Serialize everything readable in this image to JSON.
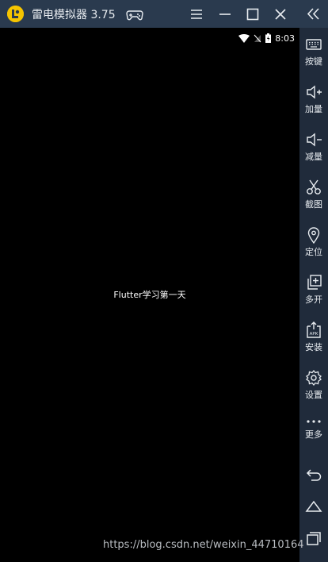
{
  "app": {
    "title": "雷电模拟器 3.75"
  },
  "status": {
    "time": "8:03"
  },
  "screen": {
    "center_text": "Flutter学习第一天",
    "watermark": "https://blog.csdn.net/weixin_44710164"
  },
  "sidebar": {
    "items": [
      {
        "label": "按键",
        "icon": "keyboard-icon"
      },
      {
        "label": "加量",
        "icon": "volume-up-icon"
      },
      {
        "label": "减量",
        "icon": "volume-down-icon"
      },
      {
        "label": "截图",
        "icon": "scissors-icon"
      },
      {
        "label": "定位",
        "icon": "location-pin-icon"
      },
      {
        "label": "多开",
        "icon": "multi-window-icon"
      },
      {
        "label": "安装",
        "icon": "apk-install-icon"
      },
      {
        "label": "设置",
        "icon": "gear-icon"
      },
      {
        "label": "更多",
        "icon": "more-dots-icon"
      }
    ]
  },
  "colors": {
    "titlebar": "#2a3a4e",
    "sidebar": "#202b3b",
    "screen": "#000000",
    "logo": "#f5c400"
  }
}
